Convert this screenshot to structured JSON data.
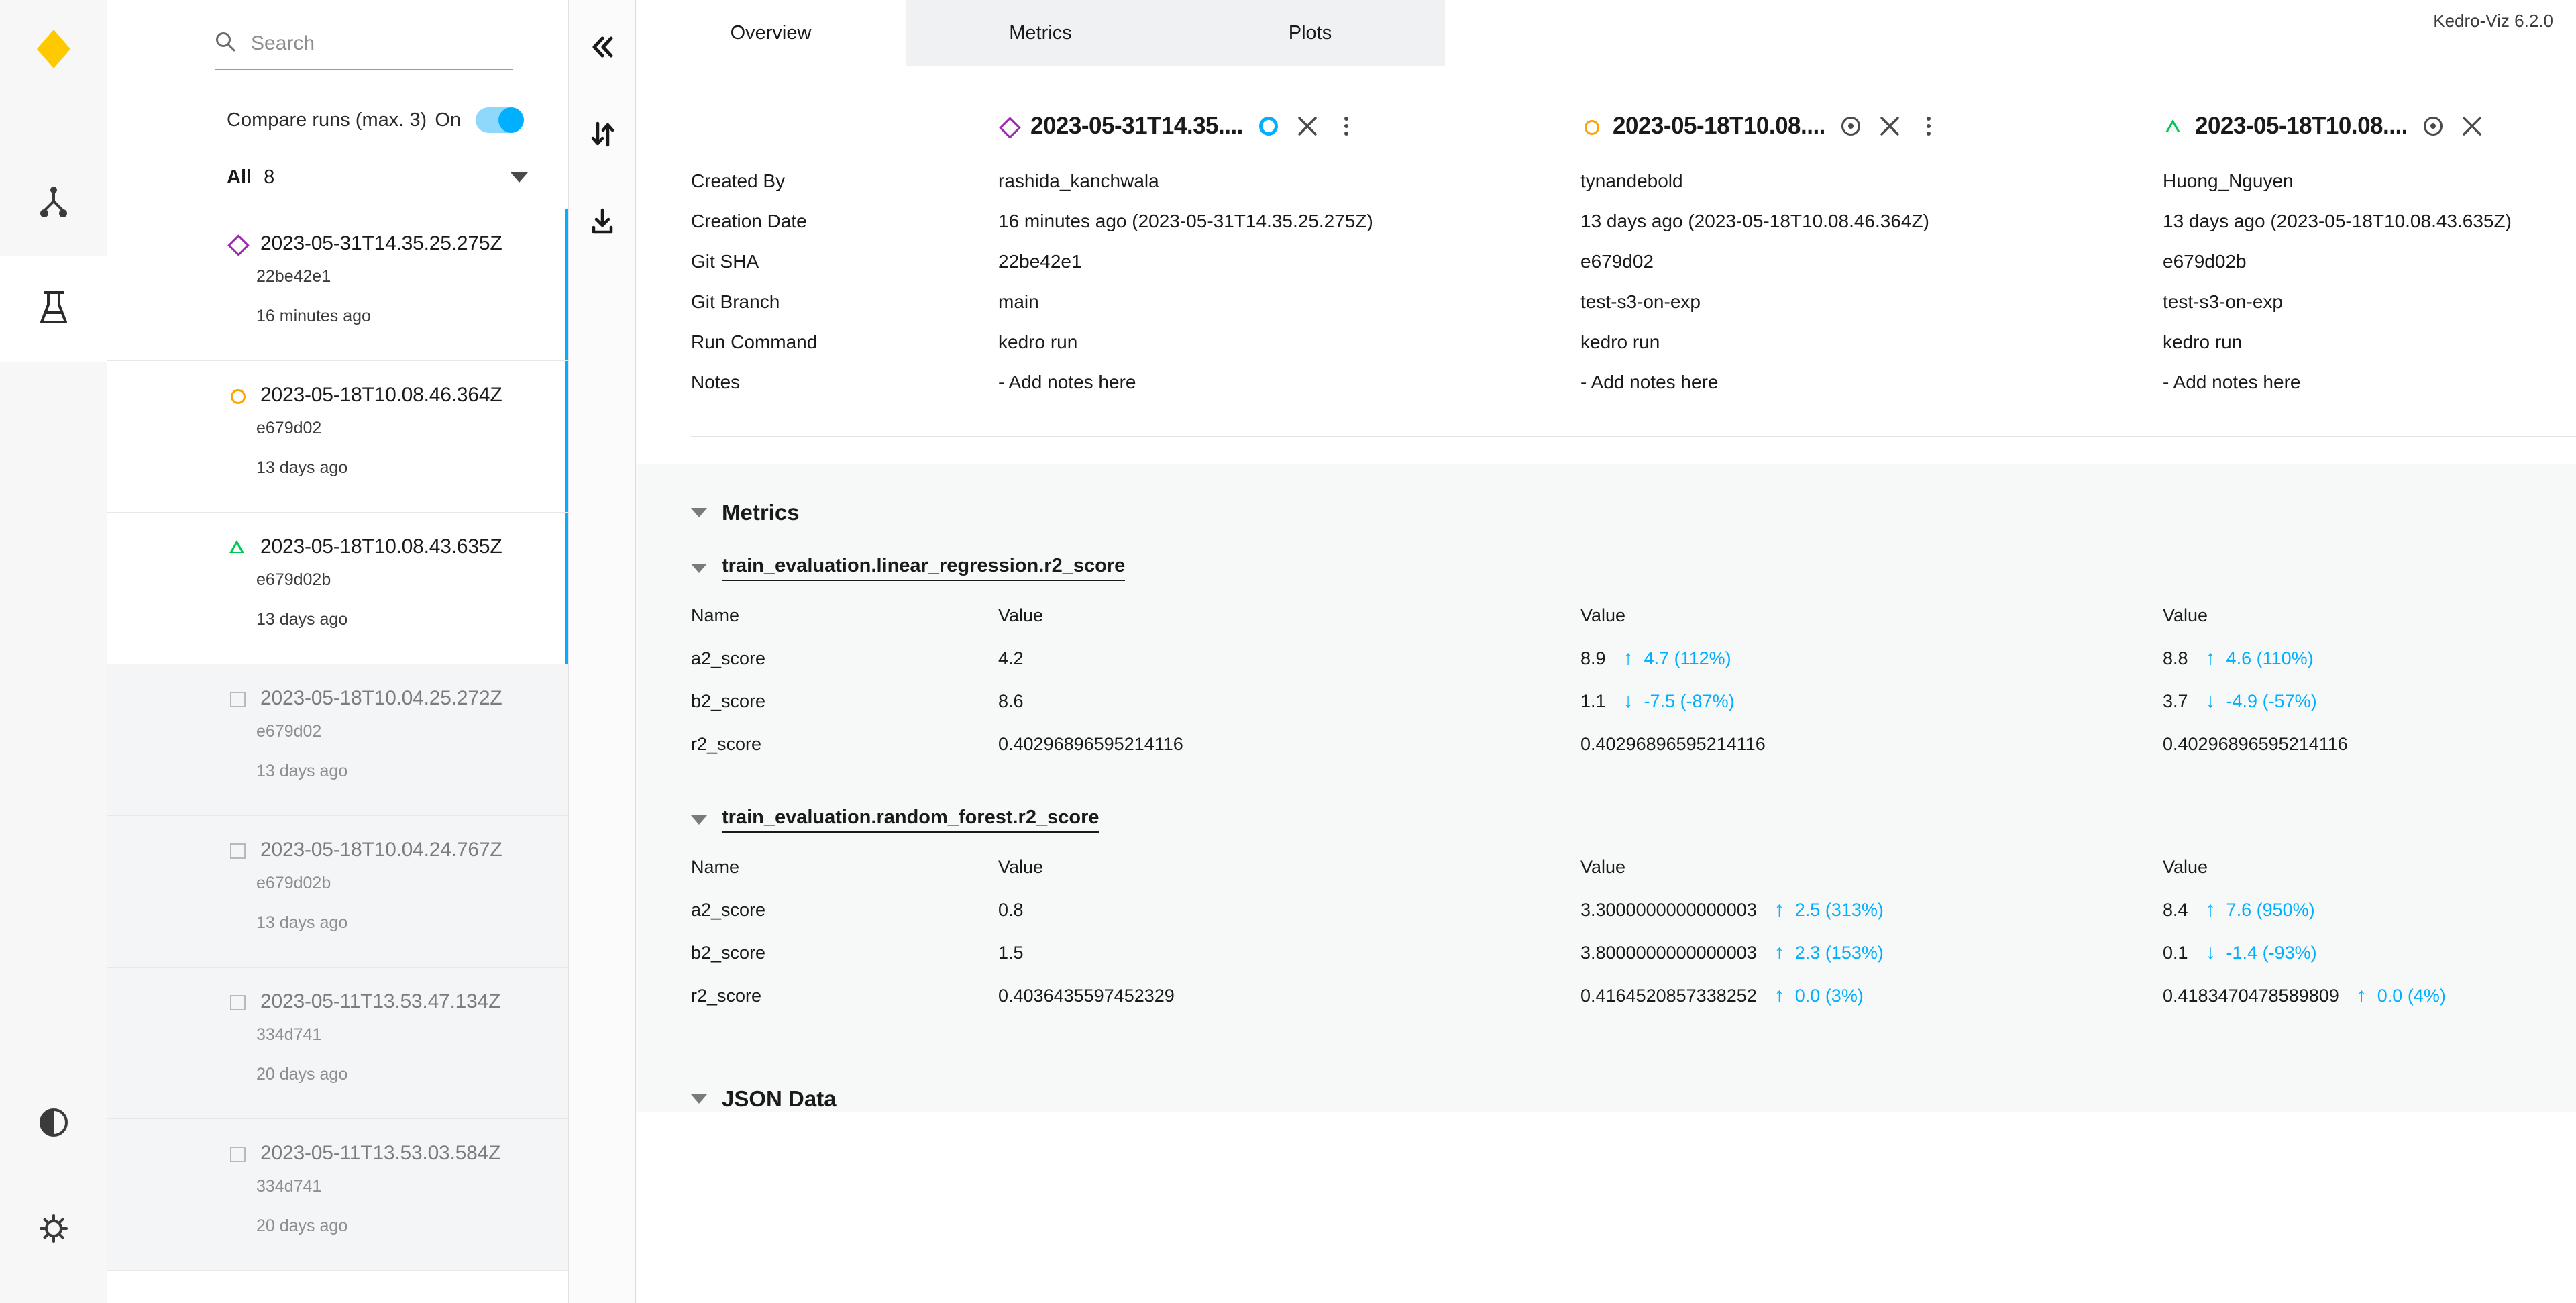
{
  "app": {
    "version_label": "Kedro-Viz 6.2.0"
  },
  "rail": {
    "logo_icon": "kedro-diamond-logo",
    "items": [
      {
        "name": "flowchart",
        "icon": "flowchart-icon",
        "active": false
      },
      {
        "name": "experiment-tracking",
        "icon": "flask-icon",
        "active": true
      },
      {
        "name": "theme-toggle",
        "icon": "contrast-icon",
        "active": false
      },
      {
        "name": "settings",
        "icon": "gear-icon",
        "active": false
      }
    ]
  },
  "sidebar": {
    "search": {
      "placeholder": "Search",
      "value": ""
    },
    "compare": {
      "label": "Compare runs (max. 3)",
      "state": "On",
      "enabled": true
    },
    "filter": {
      "label": "All",
      "count": "8"
    },
    "runs": [
      {
        "name": "2023-05-31T14.35.25.275Z",
        "sha": "22be42e1",
        "ago": "16 minutes ago",
        "shape": "diamond",
        "selected": true
      },
      {
        "name": "2023-05-18T10.08.46.364Z",
        "sha": "e679d02",
        "ago": "13 days ago",
        "shape": "circle",
        "selected": true
      },
      {
        "name": "2023-05-18T10.08.43.635Z",
        "sha": "e679d02b",
        "ago": "13 days ago",
        "shape": "triangle",
        "selected": true
      },
      {
        "name": "2023-05-18T10.04.25.272Z",
        "sha": "e679d02",
        "ago": "13 days ago",
        "shape": "square",
        "selected": false
      },
      {
        "name": "2023-05-18T10.04.24.767Z",
        "sha": "e679d02b",
        "ago": "13 days ago",
        "shape": "square",
        "selected": false
      },
      {
        "name": "2023-05-11T13.53.47.134Z",
        "sha": "334d741",
        "ago": "20 days ago",
        "shape": "square",
        "selected": false
      },
      {
        "name": "2023-05-11T13.53.03.584Z",
        "sha": "334d741",
        "ago": "20 days ago",
        "shape": "square",
        "selected": false
      }
    ]
  },
  "toolrail": {
    "collapse_icon": "double-chevron-left-icon",
    "sort_icon": "sort-arrows-icon",
    "export_icon": "download-icon"
  },
  "tabs": [
    {
      "label": "Overview",
      "active": true
    },
    {
      "label": "Metrics",
      "active": false
    },
    {
      "label": "Plots",
      "active": false
    }
  ],
  "columns": [
    {
      "title": "2023-05-31T14.35....",
      "shape": "diamond",
      "bookmarked": true,
      "has_kebab": true,
      "has_close": true
    },
    {
      "title": "2023-05-18T10.08....",
      "shape": "circle",
      "bookmarked": false,
      "has_kebab": true,
      "has_close": true
    },
    {
      "title": "2023-05-18T10.08....",
      "shape": "triangle",
      "bookmarked": false,
      "has_kebab": false,
      "has_close": true
    }
  ],
  "metadata": {
    "labels": [
      "Created By",
      "Creation Date",
      "Git SHA",
      "Git Branch",
      "Run Command",
      "Notes"
    ],
    "values": [
      [
        "rashida_kanchwala",
        "16 minutes ago (2023-05-31T14.35.25.275Z)",
        "22be42e1",
        "main",
        "kedro run",
        "- Add notes here"
      ],
      [
        "tynandebold",
        "13 days ago (2023-05-18T10.08.46.364Z)",
        "e679d02",
        "test-s3-on-exp",
        "kedro run",
        "- Add notes here"
      ],
      [
        "Huong_Nguyen",
        "13 days ago (2023-05-18T10.08.43.635Z)",
        "e679d02b",
        "test-s3-on-exp",
        "kedro run",
        "- Add notes here"
      ]
    ]
  },
  "metrics_section": {
    "title": "Metrics",
    "groups": [
      {
        "title": "train_evaluation.linear_regression.r2_score",
        "headers": [
          "Name",
          "Value",
          "Value",
          "Value"
        ],
        "rows": [
          {
            "name": "a2_score",
            "c1": {
              "value": "4.2"
            },
            "c2": {
              "value": "8.9",
              "dir": "up",
              "delta": "4.7 (112%)"
            },
            "c3": {
              "value": "8.8",
              "dir": "up",
              "delta": "4.6 (110%)"
            }
          },
          {
            "name": "b2_score",
            "c1": {
              "value": "8.6"
            },
            "c2": {
              "value": "1.1",
              "dir": "down",
              "delta": "-7.5 (-87%)"
            },
            "c3": {
              "value": "3.7",
              "dir": "down",
              "delta": "-4.9 (-57%)"
            }
          },
          {
            "name": "r2_score",
            "c1": {
              "value": "0.40296896595214116"
            },
            "c2": {
              "value": "0.40296896595214116"
            },
            "c3": {
              "value": "0.40296896595214116"
            }
          }
        ]
      },
      {
        "title": "train_evaluation.random_forest.r2_score",
        "headers": [
          "Name",
          "Value",
          "Value",
          "Value"
        ],
        "rows": [
          {
            "name": "a2_score",
            "c1": {
              "value": "0.8"
            },
            "c2": {
              "value": "3.3000000000000003",
              "dir": "up",
              "delta": "2.5 (313%)"
            },
            "c3": {
              "value": "8.4",
              "dir": "up",
              "delta": "7.6 (950%)"
            }
          },
          {
            "name": "b2_score",
            "c1": {
              "value": "1.5"
            },
            "c2": {
              "value": "3.8000000000000003",
              "dir": "up",
              "delta": "2.3 (153%)"
            },
            "c3": {
              "value": "0.1",
              "dir": "down",
              "delta": "-1.4 (-93%)"
            }
          },
          {
            "name": "r2_score",
            "c1": {
              "value": "0.4036435597452329"
            },
            "c2": {
              "value": "0.4164520857338252",
              "dir": "up",
              "delta": "0.0 (3%)"
            },
            "c3": {
              "value": "0.4183470478589809",
              "dir": "up",
              "delta": "0.0 (4%)"
            }
          }
        ]
      }
    ]
  },
  "json_section": {
    "title": "JSON Data"
  },
  "colors": {
    "accent": "#00b0ff",
    "diamond": "#9c27b0",
    "circle": "#ffa300",
    "triangle": "#00c853",
    "logo": "#ffc900"
  }
}
